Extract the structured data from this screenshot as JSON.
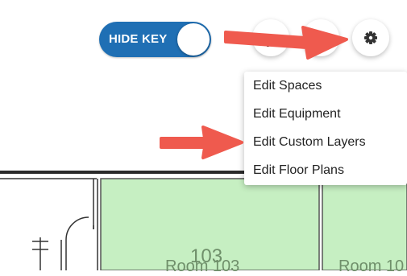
{
  "toolbar": {
    "hide_key_label": "HIDE KEY",
    "toggle_state": "on",
    "buttons": [
      {
        "icon": "layers-icon"
      },
      {
        "icon": "zoom-icon"
      },
      {
        "icon": "gear-icon"
      }
    ]
  },
  "settings_menu": {
    "items": [
      {
        "label": "Edit Spaces"
      },
      {
        "label": "Edit Equipment"
      },
      {
        "label": "Edit Custom Layers"
      },
      {
        "label": "Edit Floor Plans"
      }
    ]
  },
  "floor_plan": {
    "room_fill_color": "#c6efc2",
    "rooms": [
      {
        "number": "103",
        "name": "Room 103"
      },
      {
        "name": "Room 10"
      }
    ]
  },
  "colors": {
    "toggle_bg": "#1f6fb4",
    "annotation_arrow": "#ef5a4e"
  }
}
